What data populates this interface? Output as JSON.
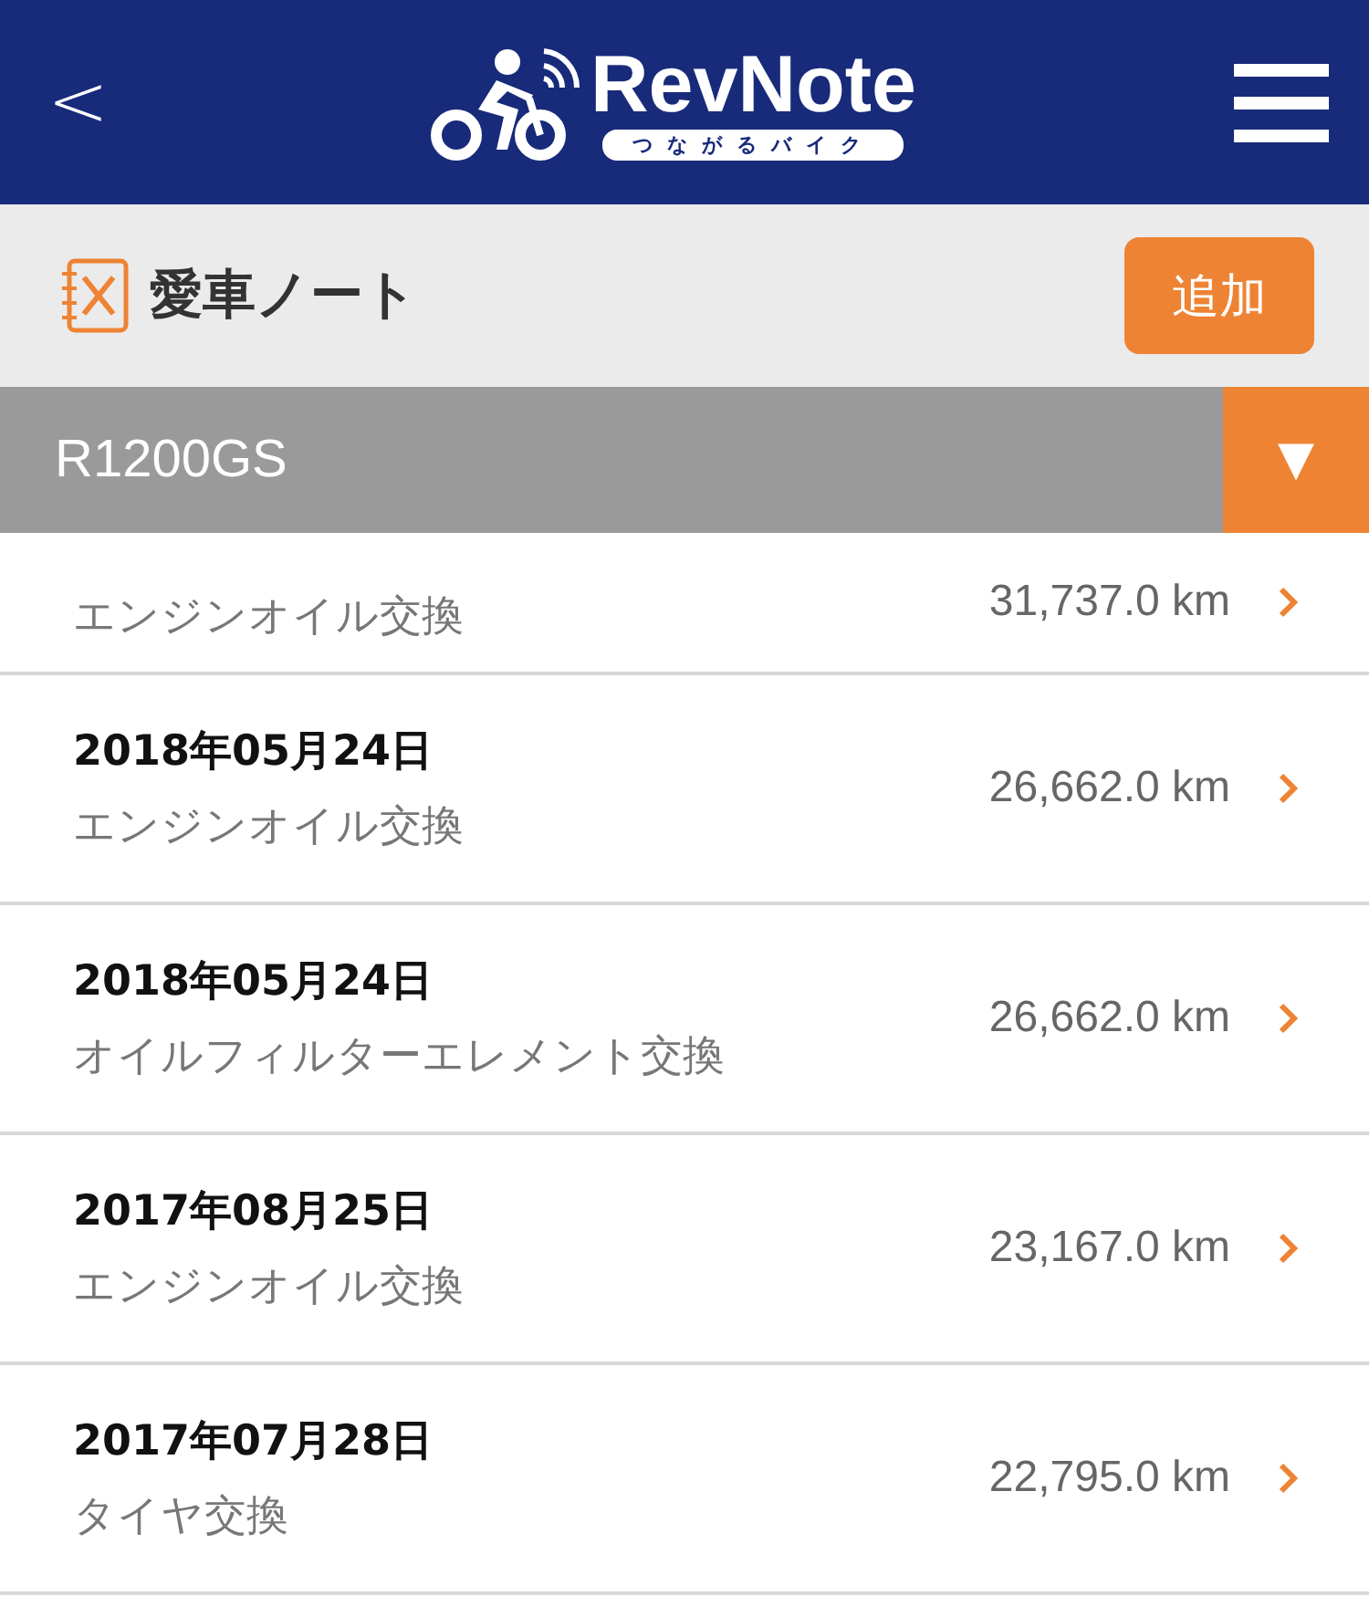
{
  "header": {
    "back": "<",
    "logo_title": "RevNote",
    "logo_tagline": "つながるバイク"
  },
  "title_bar": {
    "title": "愛車ノート",
    "add_button": "追加"
  },
  "vehicle_select": {
    "value": "R1200GS",
    "arrow": "▼"
  },
  "records": [
    {
      "description": "エンジンオイル交換",
      "odometer": "31,737.0 km"
    },
    {
      "date": "2018年05月24日",
      "description": "エンジンオイル交換",
      "odometer": "26,662.0 km"
    },
    {
      "date": "2018年05月24日",
      "description": "オイルフィルターエレメント交換",
      "odometer": "26,662.0 km"
    },
    {
      "date": "2017年08月25日",
      "description": "エンジンオイル交換",
      "odometer": "23,167.0 km"
    },
    {
      "date": "2017年07月28日",
      "description": "タイヤ交換",
      "odometer": "22,795.0 km"
    }
  ]
}
